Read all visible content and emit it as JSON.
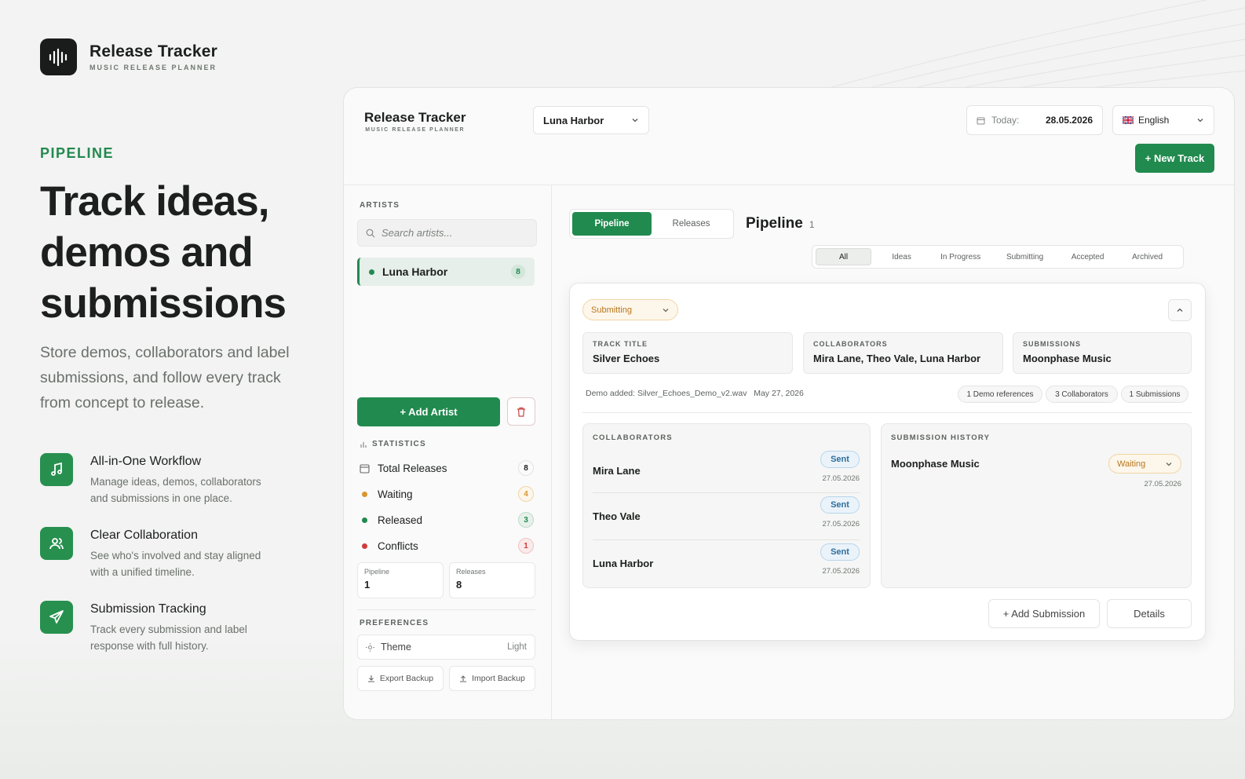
{
  "brand": {
    "title": "Release Tracker",
    "subtitle": "MUSIC RELEASE PLANNER"
  },
  "hero": {
    "eyebrow": "PIPELINE",
    "headline": "Track ideas, demos and submissions",
    "lead": "Store demos, collaborators and label submissions, and follow every track from concept to release."
  },
  "features": [
    {
      "icon": "music-note-icon",
      "title": "All-in-One Workflow",
      "desc": "Manage ideas, demos, collaborators and submissions in one place."
    },
    {
      "icon": "users-icon",
      "title": "Clear Collaboration",
      "desc": "See who's involved and stay aligned with a unified timeline."
    },
    {
      "icon": "send-icon",
      "title": "Submission Tracking",
      "desc": "Track every submission and label response with full history."
    }
  ],
  "app": {
    "topbar": {
      "artist_select": "Luna Harbor",
      "today_label": "Today:",
      "today_value": "28.05.2026",
      "language": "English",
      "new_track": "+ New Track"
    },
    "sidebar": {
      "artists_label": "ARTISTS",
      "search_placeholder": "Search artists...",
      "artist": {
        "name": "Luna Harbor",
        "count": "8"
      },
      "add_artist": "+ Add Artist",
      "statistics_label": "STATISTICS",
      "stats": [
        {
          "label": "Total Releases",
          "count": "8"
        },
        {
          "label": "Waiting",
          "count": "4"
        },
        {
          "label": "Released",
          "count": "3"
        },
        {
          "label": "Conflicts",
          "count": "1"
        }
      ],
      "mini": [
        {
          "label": "Pipeline",
          "value": "1"
        },
        {
          "label": "Releases",
          "value": "8"
        }
      ],
      "preferences_label": "PREFERENCES",
      "theme_label": "Theme",
      "theme_value": "Light",
      "export": "Export Backup",
      "import": "Import Backup"
    },
    "main": {
      "tabs": [
        "Pipeline",
        "Releases"
      ],
      "title": "Pipeline",
      "title_count": "1",
      "filters": [
        "All",
        "Ideas",
        "In Progress",
        "Submitting",
        "Accepted",
        "Archived"
      ],
      "card": {
        "status": "Submitting",
        "fields": [
          {
            "label": "TRACK TITLE",
            "value": "Silver Echoes"
          },
          {
            "label": "COLLABORATORS",
            "value": "Mira Lane, Theo Vale, Luna Harbor"
          },
          {
            "label": "SUBMISSIONS",
            "value": "Moonphase Music"
          }
        ],
        "demo_text": "Demo added: Silver_Echoes_Demo_v2.wav",
        "demo_date": "May 27, 2026",
        "chips": [
          "1 Demo references",
          "3 Collaborators",
          "1 Submissions"
        ],
        "collaborators_label": "COLLABORATORS",
        "collaborators": [
          {
            "name": "Mira Lane",
            "status": "Sent",
            "date": "27.05.2026"
          },
          {
            "name": "Theo Vale",
            "status": "Sent",
            "date": "27.05.2026"
          },
          {
            "name": "Luna Harbor",
            "status": "Sent",
            "date": "27.05.2026"
          }
        ],
        "history_label": "SUBMISSION HISTORY",
        "history": {
          "name": "Moonphase Music",
          "status": "Waiting",
          "date": "27.05.2026"
        },
        "add_submission": "+ Add Submission",
        "details": "Details"
      }
    }
  },
  "colors": {
    "accent": "#218a4e",
    "waiting": "#d8962e",
    "released": "#23894f",
    "conflict": "#cf3b3b",
    "sent": "#2f6e9c"
  }
}
